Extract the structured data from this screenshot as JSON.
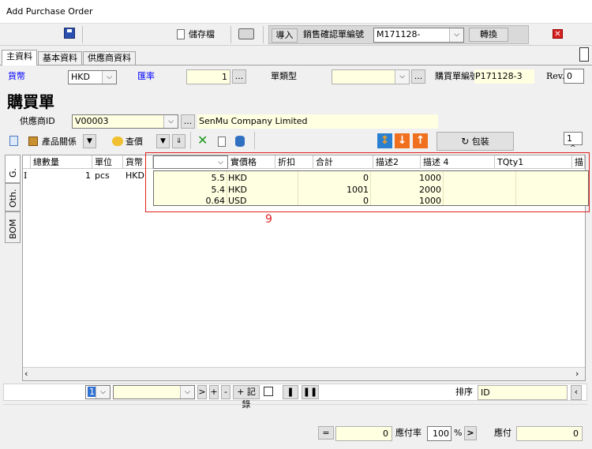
{
  "window": {
    "title": "Add Purchase Order"
  },
  "toolbar": {
    "save_file_label": "儲存檔",
    "import_label": "導入",
    "sales_confirm_label": "銷售確認單編號",
    "sales_confirm_value": "M171128-",
    "convert_label": "轉換"
  },
  "tabs": [
    "主資料",
    "基本資料",
    "供應商資料"
  ],
  "header": {
    "currency_label": "貨幣",
    "currency_value": "HKD",
    "rate_label": "匯率",
    "rate_value": "1",
    "doc_type_label": "單類型",
    "doc_type_value": "",
    "po_no_label": "購買單編號",
    "po_no_value": "P171128-3",
    "rev_label": "Rev.",
    "rev_value": "0",
    "page_title": "購買單",
    "supplier_label": "供應商ID",
    "supplier_value": "V00003",
    "supplier_name": "SenMu Company Limited"
  },
  "actions": {
    "product_relation_label": "產品關係",
    "check_price_label": "查價",
    "packing_label": "包裝",
    "page_number": "1",
    "page_caret": "^"
  },
  "side_tabs": [
    "G.",
    "Oth.",
    "BOM"
  ],
  "grid": {
    "columns": [
      "總數量",
      "單位",
      "貨幣",
      "",
      "實價格",
      "折扣",
      "合計",
      "描述2",
      "描述 4",
      "TQty1",
      "描"
    ],
    "rows": [
      {
        "marker": "I",
        "qty": "1",
        "unit": "pcs",
        "currency": "HKD"
      }
    ]
  },
  "popup": {
    "rows": [
      {
        "price": "5.5",
        "currency": "HKD",
        "total": "0",
        "desc": "1000"
      },
      {
        "price": "5.4",
        "currency": "HKD",
        "total": "1001",
        "desc": "2000"
      },
      {
        "price": "0.64",
        "currency": "USD",
        "total": "0",
        "desc": "1000"
      }
    ]
  },
  "annotation": "9",
  "footer": {
    "row_select": "1",
    "add_record_label": "+ 記錄",
    "sort_label": "排序",
    "sort_value": "ID",
    "equals_label": "=",
    "equals_value": "0",
    "payable_rate_label": "應付率",
    "payable_rate_value": "100",
    "percent_label": "%",
    "payable_label": "應付",
    "payable_value": "0"
  },
  "colors": {
    "blue_label": "#0000ff",
    "yellow_field": "#ffffe1",
    "annotation_red": "#e02020"
  }
}
